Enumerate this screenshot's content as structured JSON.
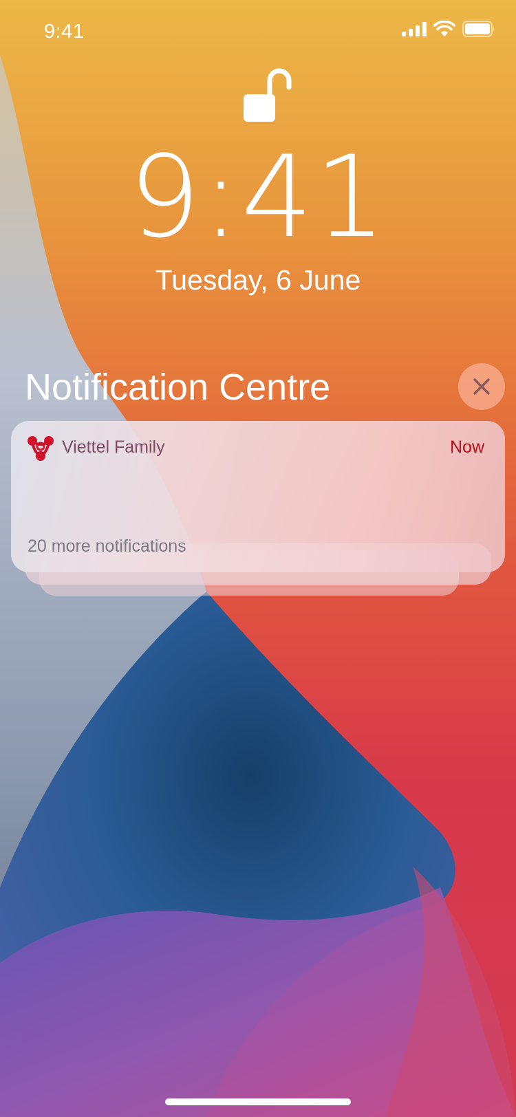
{
  "status_bar": {
    "time": "9:41",
    "icons": [
      "cellular-signal-icon",
      "wifi-icon",
      "battery-icon"
    ]
  },
  "lock_screen": {
    "lock_icon": "unlocked-padlock-icon",
    "time": "9:41",
    "date": "Tuesday, 6 June"
  },
  "notification_centre": {
    "title": "Notification Centre",
    "close_icon": "close-icon",
    "notification": {
      "app_icon": "viettel-family-logo",
      "app_name": "Viettel Family",
      "time": "Now",
      "more_text": "20 more notifications"
    }
  },
  "colors": {
    "wallpaper_top": "#EDB647",
    "wallpaper_orange": "#E4683A",
    "wallpaper_red": "#D83A44",
    "wallpaper_blue": "#2A5D95",
    "wallpaper_purple": "#9A57B0",
    "wallpaper_grey": "#B7BECC",
    "app_name": "#7E4A66",
    "notification_time": "#B5101C"
  }
}
